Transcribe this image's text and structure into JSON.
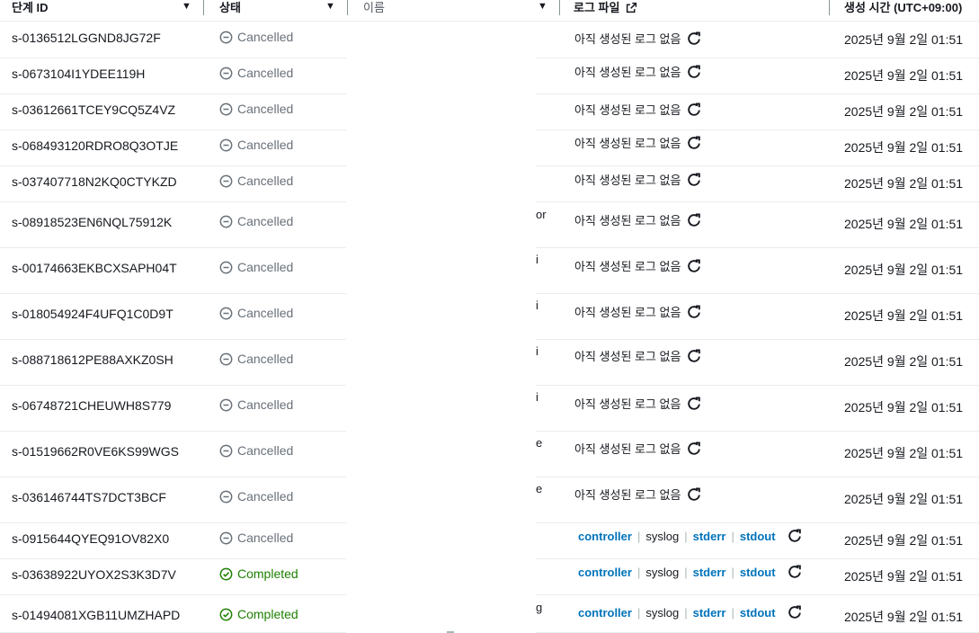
{
  "columns": {
    "step_id": "단계 ID",
    "status": "상태",
    "name": "이름",
    "log_file": "로그 파일",
    "created": "생성 시간 (UTC+09:00)"
  },
  "icons": {
    "caret": "caret-down-icon",
    "external": "external-link-icon",
    "cancelled": "cancelled-circle-icon",
    "completed": "check-circle-icon",
    "refresh": "refresh-icon"
  },
  "colors": {
    "link": "#0073bb",
    "completed": "#1d8102",
    "cancelled": "#687078"
  },
  "log_links": {
    "controller": "controller",
    "syslog": "syslog",
    "stderr": "stderr",
    "stdout": "stdout"
  },
  "rows": [
    {
      "id": "s-0136512LGGND8JG72F",
      "status": "Cancelled",
      "name": "",
      "log": "아직 생성된 로그 없음",
      "created": "2025년 9월 2일 01:51"
    },
    {
      "id": "s-0673104I1YDEE119H",
      "status": "Cancelled",
      "name": "",
      "log": "아직 생성된 로그 없음",
      "created": "2025년 9월 2일 01:51"
    },
    {
      "id": "s-03612661TCEY9CQ5Z4VZ",
      "status": "Cancelled",
      "name": "",
      "log": "아직 생성된 로그 없음",
      "created": "2025년 9월 2일 01:51"
    },
    {
      "id": "s-068493120RDRO8Q3OTJE",
      "status": "Cancelled",
      "name": "",
      "log": "아직 생성된 로그 없음",
      "created": "2025년 9월 2일 01:51"
    },
    {
      "id": "s-037407718N2KQ0CTYKZD",
      "status": "Cancelled",
      "name": "",
      "log": "아직 생성된 로그 없음",
      "created": "2025년 9월 2일 01:51"
    },
    {
      "id": "s-08918523EN6NQL75912K",
      "status": "Cancelled",
      "name": "or",
      "log": "아직 생성된 로그 없음",
      "created": "2025년 9월 2일 01:51"
    },
    {
      "id": "s-00174663EKBCXSAPH04T",
      "status": "Cancelled",
      "name": "i",
      "log": "아직 생성된 로그 없음",
      "created": "2025년 9월 2일 01:51"
    },
    {
      "id": "s-018054924F4UFQ1C0D9T",
      "status": "Cancelled",
      "name": "i",
      "log": "아직 생성된 로그 없음",
      "created": "2025년 9월 2일 01:51"
    },
    {
      "id": "s-088718612PE88AXKZ0SH",
      "status": "Cancelled",
      "name": "i",
      "log": "아직 생성된 로그 없음",
      "created": "2025년 9월 2일 01:51"
    },
    {
      "id": "s-06748721CHEUWH8S779",
      "status": "Cancelled",
      "name": "i",
      "log": "아직 생성된 로그 없음",
      "created": "2025년 9월 2일 01:51"
    },
    {
      "id": "s-01519662R0VE6KS99WGS",
      "status": "Cancelled",
      "name": "e",
      "log": "아직 생성된 로그 없음",
      "created": "2025년 9월 2일 01:51"
    },
    {
      "id": "s-036146744TS7DCT3BCF",
      "status": "Cancelled",
      "name": "e",
      "log": "아직 생성된 로그 없음",
      "created": "2025년 9월 2일 01:51"
    },
    {
      "id": "s-0915644QYEQ91OV82X0",
      "status": "Cancelled",
      "name": "",
      "log": "",
      "created": "2025년 9월 2일 01:51"
    },
    {
      "id": "s-03638922UYOX2S3K3D7V",
      "status": "Completed",
      "name": "",
      "log": "",
      "created": "2025년 9월 2일 01:51"
    },
    {
      "id": "s-01494081XGB11UMZHAPD",
      "status": "Completed",
      "name": "g",
      "log": "",
      "created": "2025년 9월 2일 01:51"
    }
  ]
}
